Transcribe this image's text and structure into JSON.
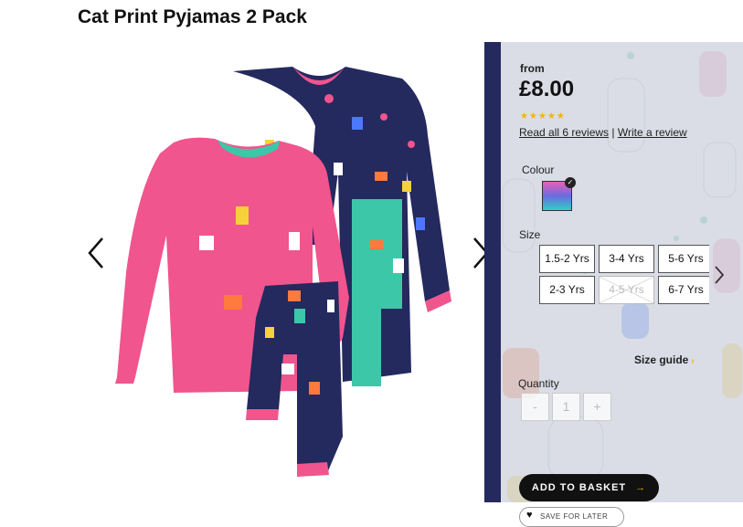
{
  "product": {
    "title": "Cat Print Pyjamas 2 Pack",
    "image_alt": "Cat print pyjamas pink and navy"
  },
  "gallery": {
    "prev_icon": "chevron-left-icon",
    "next_icon": "chevron-right-icon"
  },
  "pricing": {
    "from_label": "from",
    "price": "£8.00",
    "rating_stars": 4.5,
    "rating_max": 5,
    "read_reviews": "Read all 6 reviews",
    "separator": "|",
    "write_review": "Write a review"
  },
  "colour": {
    "label": "Colour",
    "selected_icon": "checkmark-icon"
  },
  "size": {
    "label": "Size",
    "options": [
      {
        "label": "1.5-2 Yrs",
        "available": true
      },
      {
        "label": "3-4 Yrs",
        "available": true
      },
      {
        "label": "5-6 Yrs",
        "available": true
      },
      {
        "label": "2-3 Yrs",
        "available": true
      },
      {
        "label": "4-5 Yrs",
        "available": false
      },
      {
        "label": "6-7 Yrs",
        "available": true
      }
    ],
    "guide_label": "Size guide",
    "guide_icon": "chevron-right-icon"
  },
  "quantity": {
    "label": "Quantity",
    "minus": "-",
    "value": "1",
    "plus": "+"
  },
  "actions": {
    "add_to_basket": "ADD TO BASKET",
    "add_icon": "arrow-right-icon",
    "save_for_later": "SAVE FOR LATER",
    "save_icon": "heart-icon"
  },
  "colors": {
    "star": "#f5b400",
    "button_bg": "#111111",
    "panel_overlay": "#d2d5e1",
    "pink_top": "#f0558d",
    "navy_top": "#24295e",
    "teal": "#3cc7a8"
  }
}
